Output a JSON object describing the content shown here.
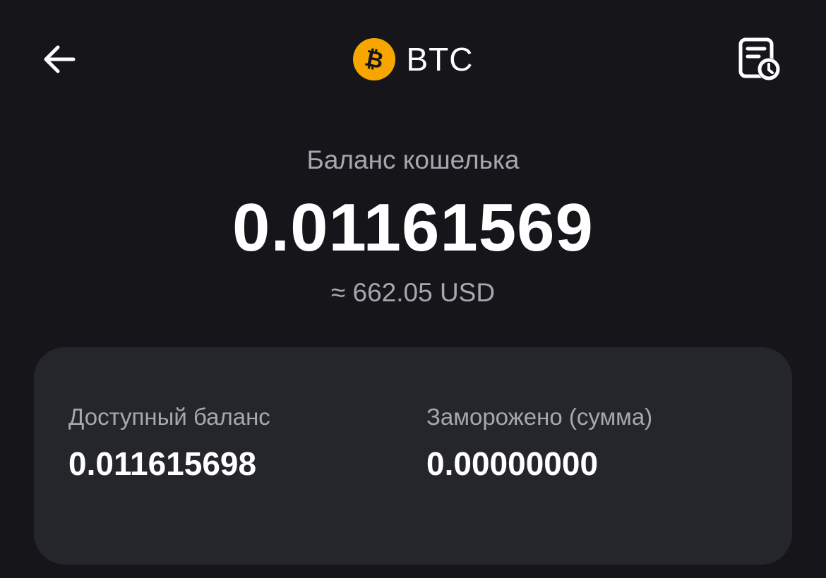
{
  "header": {
    "coin_symbol": "BTC",
    "coin_icon": "bitcoin-icon",
    "back_icon": "arrow-left-icon",
    "history_icon": "document-clock-icon"
  },
  "balance": {
    "label": "Баланс кошелька",
    "value": "0.01161569",
    "fiat": "≈ 662.05 USD"
  },
  "details": {
    "available_label": "Доступный баланс",
    "available_value": "0.011615698",
    "frozen_label": "Заморожено (сумма)",
    "frozen_value": "0.00000000"
  },
  "colors": {
    "background": "#16161a",
    "card": "#25262b",
    "accent_btc": "#f7a600",
    "secondary_text": "#a6a8ae"
  }
}
